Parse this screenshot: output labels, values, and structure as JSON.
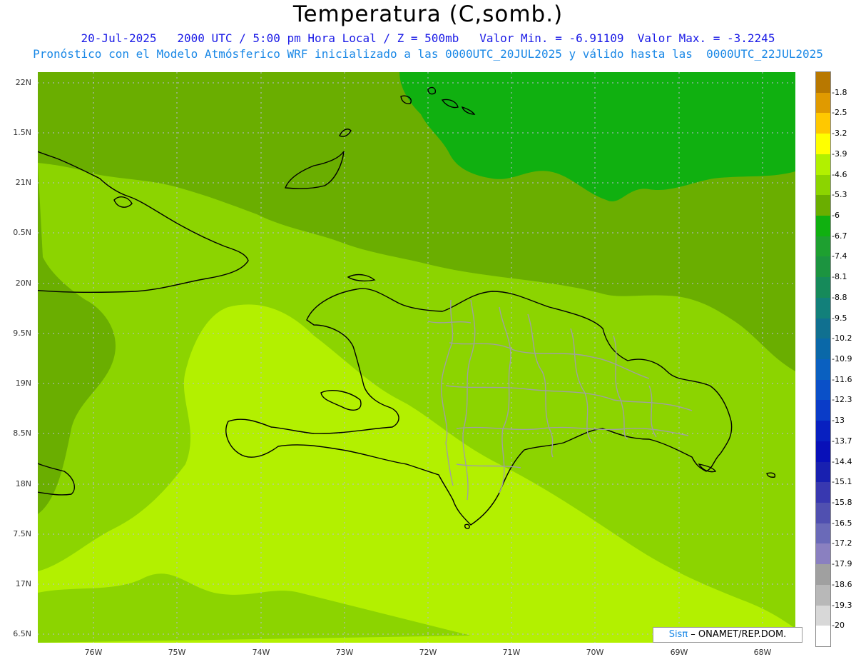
{
  "title": "Temperatura (C,somb.)",
  "subtitle1": "20-Jul-2025   2000 UTC / 5:00 pm Hora Local / Z = 500mb   Valor Min. = -6.91109  Valor Max. = -3.2245",
  "subtitle2": "Pronóstico con el Modelo Atmósferico WRF inicializado a las 0000UTC_20JUL2025 y válido hasta las  0000UTC_22JUL2025",
  "credit": {
    "sis": "Sisπ",
    "rest": " – ONAMET/REP.DOM."
  },
  "lat_labels": [
    "22N",
    "1.5N",
    "21N",
    "0.5N",
    "20N",
    "9.5N",
    "19N",
    "8.5N",
    "18N",
    "7.5N",
    "17N",
    "6.5N"
  ],
  "lon_labels": [
    "76W",
    "75W",
    "74W",
    "73W",
    "72W",
    "71W",
    "70W",
    "69W",
    "68W"
  ],
  "legend": {
    "labels": [
      "-1.8",
      "-2.5",
      "-3.2",
      "-3.9",
      "-4.6",
      "-5.3",
      "-6",
      "-6.7",
      "-7.4",
      "-8.1",
      "-8.8",
      "-9.5",
      "-10.2",
      "-10.9",
      "-11.6",
      "-12.3",
      "-13",
      "-13.7",
      "-14.4",
      "-15.1",
      "-15.8",
      "-16.5",
      "-17.2",
      "-17.9",
      "-18.6",
      "-19.3",
      "-20"
    ],
    "colors": [
      "#b87800",
      "#e09a00",
      "#ffc800",
      "#ffff00",
      "#b2f000",
      "#8cd400",
      "#6aae00",
      "#10b010",
      "#1ea030",
      "#1c9440",
      "#168a5a",
      "#12807a",
      "#107090",
      "#0a68a8",
      "#0a60c0",
      "#0a50c8",
      "#0a3cc8",
      "#0820c0",
      "#0810b8",
      "#1820b0",
      "#3838b0",
      "#5050b0",
      "#6a6ab8",
      "#8a80c0",
      "#a0a0a0",
      "#b8b8b8",
      "#d8d8d8",
      "#ffffff"
    ]
  },
  "colors": {
    "warm": "#b3f000",
    "mid": "#8cd400",
    "cool": "#6aae00",
    "coolest": "#10b010"
  }
}
